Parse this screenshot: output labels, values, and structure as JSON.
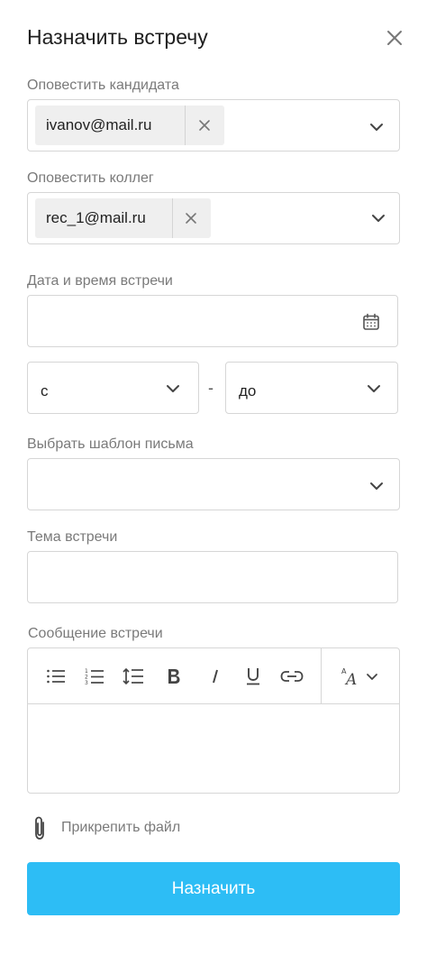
{
  "header": {
    "title": "Назначить встречу",
    "close_icon": "close-icon"
  },
  "notify_candidate": {
    "label": "Оповестить кандидата",
    "chips": [
      {
        "value": "ivanov@mail.ru"
      }
    ]
  },
  "notify_colleagues": {
    "label": "Оповестить коллег",
    "chips": [
      {
        "value": "rec_1@mail.ru"
      }
    ]
  },
  "datetime": {
    "label": "Дата и время встречи",
    "value": "",
    "icon": "calendar-icon"
  },
  "time_range": {
    "from_label": "с",
    "separator": "-",
    "to_label": "до"
  },
  "template": {
    "label": "Выбрать шаблон письма",
    "value": ""
  },
  "subject": {
    "label": "Тема встречи",
    "value": ""
  },
  "message": {
    "label": "Сообщение встречи",
    "toolbar": [
      "bullet-list-icon",
      "numbered-list-icon",
      "line-height-icon",
      "bold-icon",
      "italic-icon",
      "underline-icon",
      "link-icon",
      "font-size-icon"
    ],
    "value": ""
  },
  "attach": {
    "label": "Прикрепить файл",
    "icon": "paperclip-icon"
  },
  "submit": {
    "label": "Назначить"
  },
  "colors": {
    "accent": "#2dbdf5",
    "label": "#7a7a7a",
    "border": "#d6d6d6",
    "chip_bg": "#efefef"
  }
}
